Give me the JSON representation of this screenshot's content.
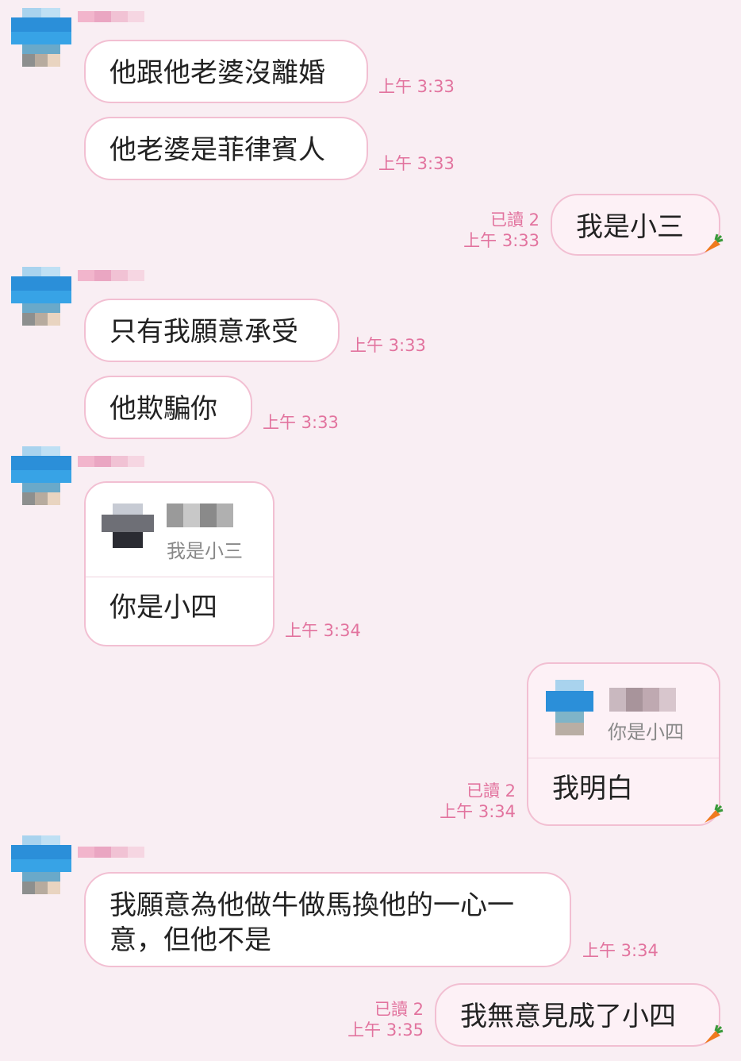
{
  "messages": [
    {
      "text": "他跟他老婆沒離婚",
      "time": "上午 3:33"
    },
    {
      "text": "他老婆是菲律賓人",
      "time": "上午 3:33"
    },
    {
      "text": "我是小三",
      "read": "已讀 2",
      "time": "上午 3:33"
    },
    {
      "text": "只有我願意承受",
      "time": "上午 3:33"
    },
    {
      "text": "他欺騙你",
      "time": "上午 3:33"
    },
    {
      "quote": "我是小三",
      "text": "你是小四",
      "time": "上午 3:34"
    },
    {
      "quote": "你是小四",
      "text": "我明白",
      "read": "已讀 2",
      "time": "上午 3:34"
    },
    {
      "text_line1": "我願意為他做牛做馬換他的一心一",
      "text_line2": "意，但他不是",
      "time": "上午 3:34"
    },
    {
      "text": "我無意見成了小四",
      "read": "已讀 2",
      "time": "上午 3:35"
    }
  ],
  "colors": {
    "background": "#f9eef3",
    "bubble_border": "#f2bfd2",
    "timestamp": "#e2739e"
  }
}
